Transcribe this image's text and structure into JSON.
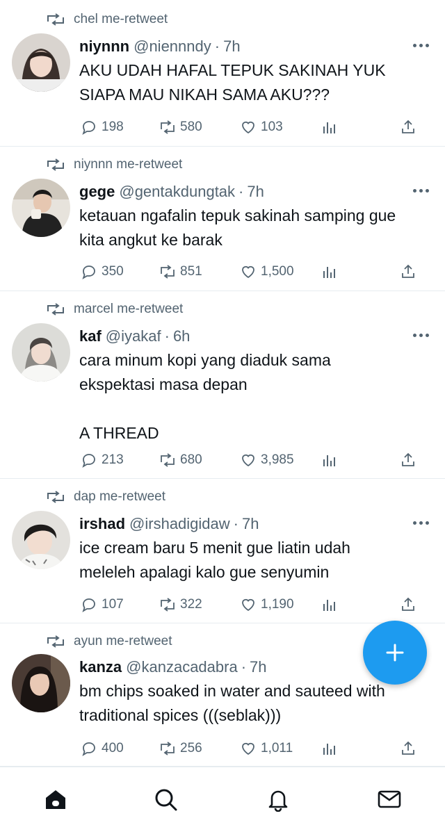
{
  "colors": {
    "accent": "#1d9bf0",
    "text": "#0f1419",
    "secondary": "#536471",
    "divider": "#e6ecf0"
  },
  "tweets": [
    {
      "retweeted_by": "chel me-retweet",
      "name": "niynnn",
      "handle": "@niennndy",
      "time": "7h",
      "text": "AKU UDAH HAFAL TEPUK SAKINAH YUK\nSIAPA MAU NIKAH SAMA AKU???",
      "replies": "198",
      "retweets": "580",
      "likes": "103"
    },
    {
      "retweeted_by": "niynnn me-retweet",
      "name": "gege",
      "handle": "@gentakdungtak",
      "time": "7h",
      "text": "ketauan ngafalin tepuk sakinah samping gue\nkita angkut ke barak",
      "replies": "350",
      "retweets": "851",
      "likes": "1,500"
    },
    {
      "retweeted_by": "marcel me-retweet",
      "name": "kaf",
      "handle": "@iyakaf",
      "time": "6h",
      "text": "cara minum kopi yang diaduk sama\nekspektasi masa depan\n\nA THREAD",
      "replies": "213",
      "retweets": "680",
      "likes": "3,985"
    },
    {
      "retweeted_by": "dap me-retweet",
      "name": "irshad",
      "handle": "@irshadigidaw",
      "time": "7h",
      "text": "ice cream baru 5 menit gue liatin udah\nmeleleh apalagi kalo gue senyumin",
      "replies": "107",
      "retweets": "322",
      "likes": "1,190"
    },
    {
      "retweeted_by": "ayun me-retweet",
      "name": "kanza",
      "handle": "@kanzacadabra",
      "time": "7h",
      "text": "bm chips soaked in water and sauteed with\ntraditional spices (((seblak)))",
      "replies": "400",
      "retweets": "256",
      "likes": "1,011"
    }
  ],
  "dot_separator": "·",
  "icons": {
    "retweet_indicator": "retweet-icon",
    "reply": "reply-icon",
    "retweet": "retweet-icon",
    "like": "heart-icon",
    "views": "views-icon",
    "share": "share-icon",
    "more": "more-icon",
    "compose": "plus-icon",
    "nav": [
      "home-icon",
      "search-icon",
      "bell-icon",
      "mail-icon"
    ]
  }
}
